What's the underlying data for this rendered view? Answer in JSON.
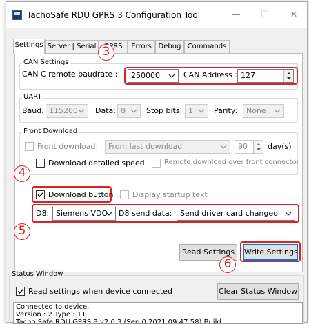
{
  "window": {
    "title": "TachoSafe RDU GPRS 3 Configuration Tool",
    "minimize": "—",
    "maximize": "☐",
    "close": "✕"
  },
  "tabs": [
    {
      "label": "Settings",
      "active": true
    },
    {
      "label": "Server | Serial"
    },
    {
      "label": "GPRS"
    },
    {
      "label": "Errors"
    },
    {
      "label": "Debug"
    },
    {
      "label": "Commands"
    }
  ],
  "can": {
    "group_title": "CAN Settings",
    "baudrate_label": "CAN C remote baudrate :",
    "baudrate_value": "250000",
    "address_label": "CAN Address :",
    "address_value": "127"
  },
  "uart": {
    "group_title": "UART",
    "baud_label": "Baud:",
    "baud_value": "115200",
    "data_label": "Data:",
    "data_value": "8",
    "stop_label": "Stop bits:",
    "stop_value": "1",
    "parity_label": "Parity:",
    "parity_value": "None"
  },
  "front_download": {
    "group_title": "Front Download",
    "front_label": "Front download:",
    "front_value": "From last download",
    "days_value": "90",
    "days_label": "day(s)",
    "detailed_label": "Download detailed speed",
    "remote_label": "Remote download over front connector"
  },
  "download": {
    "button_label": "Download button",
    "button_checked": true,
    "startup_label": "Display startup text"
  },
  "d8": {
    "label": "D8:",
    "value": "Siemens VDO",
    "send_label": "D8 send data:",
    "send_value": "Send driver card changed"
  },
  "actions": {
    "read": "Read Settings",
    "write": "Write Settings"
  },
  "status": {
    "group_title": "Status Window",
    "read_on_connect_label": "Read settings when device connected",
    "read_on_connect_checked": true,
    "clear_label": "Clear Status Window",
    "lines": [
      "Connected to device.",
      "Version : 2 Type : 11",
      "Tacho Safe RDU GPRS 3 v2.0.3 (Sep 0 2021 09:47:58) Build"
    ]
  },
  "callouts": [
    "3",
    "4",
    "5",
    "6"
  ],
  "colors": {
    "callout": "#e02020",
    "accent": "#0078d7",
    "pane": "#ffffff",
    "window": "#f0f0f0"
  }
}
